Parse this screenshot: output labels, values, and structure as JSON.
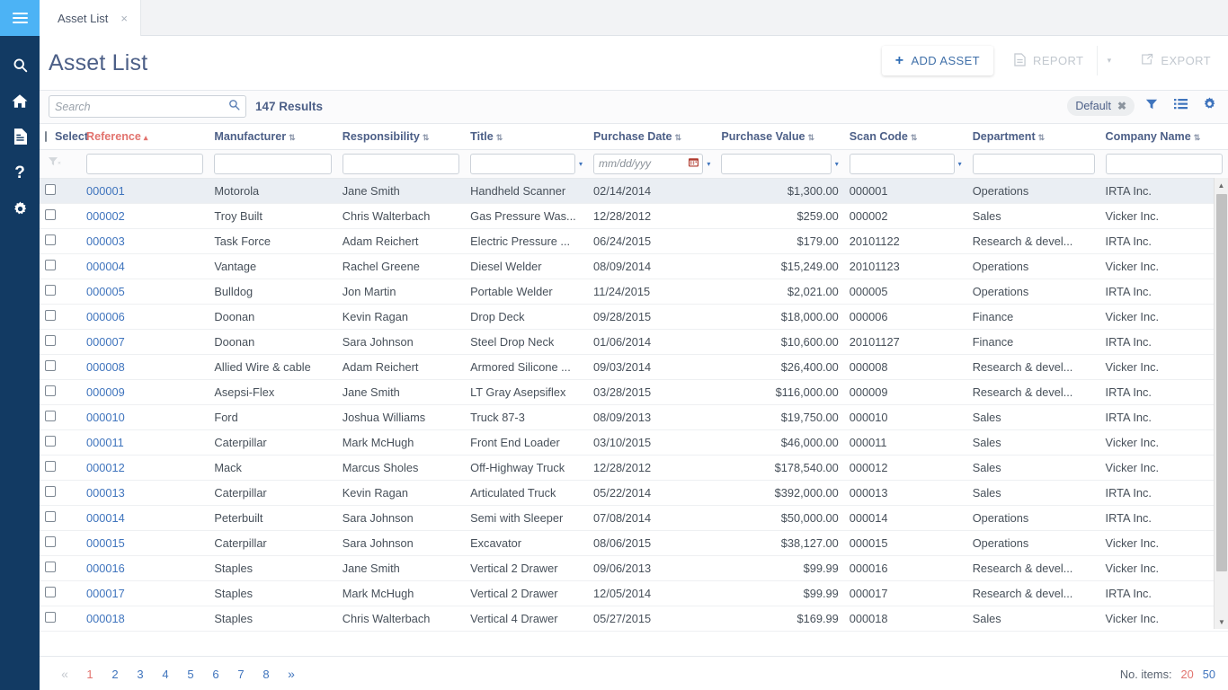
{
  "sidebar": {
    "menu_icon": "hamburger-icon",
    "items": [
      {
        "icon": "search-icon",
        "name": "search"
      },
      {
        "icon": "home-icon",
        "name": "home"
      },
      {
        "icon": "document-icon",
        "name": "documents"
      },
      {
        "icon": "question-icon",
        "name": "help"
      },
      {
        "icon": "gear-icon",
        "name": "settings"
      }
    ]
  },
  "tabs": [
    {
      "label": "Asset List",
      "close": "×"
    }
  ],
  "header": {
    "title": "Asset List",
    "add_asset_label": "ADD ASSET",
    "add_asset_plus": "+",
    "report_label": "REPORT",
    "report_caret": "▾",
    "export_label": "EXPORT"
  },
  "toolbar": {
    "search_placeholder": "Search",
    "search_value": "",
    "results_text": "147 Results",
    "view_chip": "Default",
    "view_chip_close": "✖",
    "filter_icon": "filter-icon",
    "list_icon": "list-icon",
    "settings_icon": "gear-icon"
  },
  "table": {
    "select_header": "Select",
    "columns": [
      {
        "key": "reference",
        "label": "Reference",
        "sorted": true,
        "sort_dir": "▴",
        "sort_glyph": "▴",
        "align": "left"
      },
      {
        "key": "manufacturer",
        "label": "Manufacturer",
        "sorted": false,
        "sort_glyph": "⇅",
        "align": "left"
      },
      {
        "key": "responsibility",
        "label": "Responsibility",
        "sorted": false,
        "sort_glyph": "⇅",
        "align": "left"
      },
      {
        "key": "title",
        "label": "Title",
        "sorted": false,
        "sort_glyph": "⇅",
        "align": "left"
      },
      {
        "key": "purchase_date",
        "label": "Purchase Date",
        "sorted": false,
        "sort_glyph": "⇅",
        "align": "left"
      },
      {
        "key": "purchase_value",
        "label": "Purchase Value",
        "sorted": false,
        "sort_glyph": "⇅",
        "align": "right"
      },
      {
        "key": "scan_code",
        "label": "Scan Code",
        "sorted": false,
        "sort_glyph": "⇅",
        "align": "left"
      },
      {
        "key": "department",
        "label": "Department",
        "sorted": false,
        "sort_glyph": "⇅",
        "align": "left"
      },
      {
        "key": "company_name",
        "label": "Company Name",
        "sorted": false,
        "sort_glyph": "⇅",
        "align": "left"
      }
    ],
    "filters": {
      "clear_icon": "clear-filter-icon",
      "reference": "",
      "manufacturer": "",
      "responsibility": "",
      "title": "",
      "purchase_date_placeholder": "mm/dd/yyy",
      "purchase_value": "",
      "scan_code": "",
      "department": "",
      "company_name": ""
    },
    "rows": [
      {
        "selected": true,
        "reference": "000001",
        "manufacturer": "Motorola",
        "responsibility": "Jane Smith",
        "title": "Handheld Scanner",
        "purchase_date": "02/14/2014",
        "purchase_value": "$1,300.00",
        "scan_code": "000001",
        "department": "Operations",
        "company_name": "IRTA Inc."
      },
      {
        "selected": false,
        "reference": "000002",
        "manufacturer": "Troy Built",
        "responsibility": "Chris Walterbach",
        "title": "Gas Pressure Was...",
        "purchase_date": "12/28/2012",
        "purchase_value": "$259.00",
        "scan_code": "000002",
        "department": "Sales",
        "company_name": "Vicker Inc."
      },
      {
        "selected": false,
        "reference": "000003",
        "manufacturer": "Task Force",
        "responsibility": "Adam Reichert",
        "title": "Electric Pressure ...",
        "purchase_date": "06/24/2015",
        "purchase_value": "$179.00",
        "scan_code": "20101122",
        "department": "Research & devel...",
        "company_name": "IRTA Inc."
      },
      {
        "selected": false,
        "reference": "000004",
        "manufacturer": "Vantage",
        "responsibility": "Rachel Greene",
        "title": "Diesel Welder",
        "purchase_date": "08/09/2014",
        "purchase_value": "$15,249.00",
        "scan_code": "20101123",
        "department": "Operations",
        "company_name": "Vicker Inc."
      },
      {
        "selected": false,
        "reference": "000005",
        "manufacturer": "Bulldog",
        "responsibility": "Jon Martin",
        "title": "Portable Welder",
        "purchase_date": "11/24/2015",
        "purchase_value": "$2,021.00",
        "scan_code": "000005",
        "department": "Operations",
        "company_name": "IRTA Inc."
      },
      {
        "selected": false,
        "reference": "000006",
        "manufacturer": "Doonan",
        "responsibility": "Kevin Ragan",
        "title": "Drop Deck",
        "purchase_date": "09/28/2015",
        "purchase_value": "$18,000.00",
        "scan_code": "000006",
        "department": "Finance",
        "company_name": "Vicker Inc."
      },
      {
        "selected": false,
        "reference": "000007",
        "manufacturer": "Doonan",
        "responsibility": "Sara Johnson",
        "title": "Steel Drop Neck",
        "purchase_date": "01/06/2014",
        "purchase_value": "$10,600.00",
        "scan_code": "20101127",
        "department": "Finance",
        "company_name": "IRTA Inc."
      },
      {
        "selected": false,
        "reference": "000008",
        "manufacturer": "Allied Wire & cable",
        "responsibility": "Adam Reichert",
        "title": "Armored Silicone ...",
        "purchase_date": "09/03/2014",
        "purchase_value": "$26,400.00",
        "scan_code": "000008",
        "department": "Research & devel...",
        "company_name": "Vicker Inc."
      },
      {
        "selected": false,
        "reference": "000009",
        "manufacturer": "Asepsi-Flex",
        "responsibility": "Jane Smith",
        "title": "LT Gray Asepsiflex",
        "purchase_date": "03/28/2015",
        "purchase_value": "$116,000.00",
        "scan_code": "000009",
        "department": "Research & devel...",
        "company_name": "IRTA Inc."
      },
      {
        "selected": false,
        "reference": "000010",
        "manufacturer": "Ford",
        "responsibility": "Joshua Williams",
        "title": "Truck 87-3",
        "purchase_date": "08/09/2013",
        "purchase_value": "$19,750.00",
        "scan_code": "000010",
        "department": "Sales",
        "company_name": "IRTA Inc."
      },
      {
        "selected": false,
        "reference": "000011",
        "manufacturer": "Caterpillar",
        "responsibility": "Mark McHugh",
        "title": "Front End Loader",
        "purchase_date": "03/10/2015",
        "purchase_value": "$46,000.00",
        "scan_code": "000011",
        "department": "Sales",
        "company_name": "Vicker Inc."
      },
      {
        "selected": false,
        "reference": "000012",
        "manufacturer": "Mack",
        "responsibility": "Marcus Sholes",
        "title": "Off-Highway Truck",
        "purchase_date": "12/28/2012",
        "purchase_value": "$178,540.00",
        "scan_code": "000012",
        "department": "Sales",
        "company_name": "Vicker Inc."
      },
      {
        "selected": false,
        "reference": "000013",
        "manufacturer": "Caterpillar",
        "responsibility": "Kevin Ragan",
        "title": "Articulated Truck",
        "purchase_date": "05/22/2014",
        "purchase_value": "$392,000.00",
        "scan_code": "000013",
        "department": "Sales",
        "company_name": "IRTA Inc."
      },
      {
        "selected": false,
        "reference": "000014",
        "manufacturer": "Peterbuilt",
        "responsibility": "Sara Johnson",
        "title": "Semi with Sleeper",
        "purchase_date": "07/08/2014",
        "purchase_value": "$50,000.00",
        "scan_code": "000014",
        "department": "Operations",
        "company_name": "IRTA Inc."
      },
      {
        "selected": false,
        "reference": "000015",
        "manufacturer": "Caterpillar",
        "responsibility": "Sara Johnson",
        "title": "Excavator",
        "purchase_date": "08/06/2015",
        "purchase_value": "$38,127.00",
        "scan_code": "000015",
        "department": "Operations",
        "company_name": "Vicker Inc."
      },
      {
        "selected": false,
        "reference": "000016",
        "manufacturer": "Staples",
        "responsibility": "Jane Smith",
        "title": "Vertical 2 Drawer",
        "purchase_date": "09/06/2013",
        "purchase_value": "$99.99",
        "scan_code": "000016",
        "department": "Research & devel...",
        "company_name": "Vicker Inc."
      },
      {
        "selected": false,
        "reference": "000017",
        "manufacturer": "Staples",
        "responsibility": "Mark McHugh",
        "title": "Vertical 2 Drawer",
        "purchase_date": "12/05/2014",
        "purchase_value": "$99.99",
        "scan_code": "000017",
        "department": "Research & devel...",
        "company_name": "IRTA Inc."
      },
      {
        "selected": false,
        "reference": "000018",
        "manufacturer": "Staples",
        "responsibility": "Chris Walterbach",
        "title": "Vertical 4 Drawer",
        "purchase_date": "05/27/2015",
        "purchase_value": "$169.99",
        "scan_code": "000018",
        "department": "Sales",
        "company_name": "Vicker Inc."
      }
    ]
  },
  "footer": {
    "first_glyph": "«",
    "last_glyph": "»",
    "pages": [
      "1",
      "2",
      "3",
      "4",
      "5",
      "6",
      "7",
      "8"
    ],
    "active_page": "1",
    "no_items_label": "No. items:",
    "page_sizes": [
      "20",
      "50"
    ],
    "active_page_size": "20"
  }
}
